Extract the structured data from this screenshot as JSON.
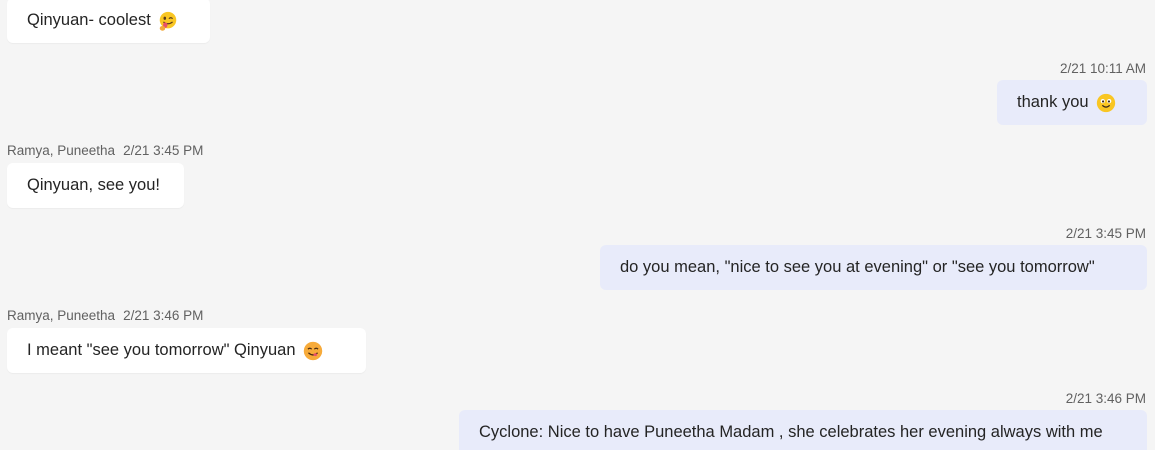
{
  "messages": [
    {
      "type": "incoming",
      "text": "Qinyuan- coolest",
      "emoji": "yum-tongue-emoji"
    },
    {
      "type": "outgoing",
      "time": "2/21 10:11 AM",
      "text": "thank you",
      "emoji": "smiling-emoji"
    },
    {
      "type": "incoming",
      "author": "Ramya, Puneetha",
      "time": "2/21 3:45 PM",
      "text": "Qinyuan, see you!"
    },
    {
      "type": "outgoing",
      "time": "2/21 3:45 PM",
      "text": "do you mean, \"nice to see you at evening\" or \"see you tomorrow\""
    },
    {
      "type": "incoming",
      "author": "Ramya, Puneetha",
      "time": "2/21 3:46 PM",
      "text": "I meant \"see you tomorrow\" Qinyuan",
      "emoji": "yum-emoji"
    },
    {
      "type": "outgoing",
      "time": "2/21 3:46 PM",
      "text": "Cyclone: Nice to have Puneetha Madam , she celebrates her evening always with me"
    }
  ],
  "colors": {
    "background": "#f5f5f5",
    "incoming_bubble": "#ffffff",
    "outgoing_bubble": "#e8ebfa",
    "meta_text": "#616161",
    "message_text": "#242424"
  }
}
